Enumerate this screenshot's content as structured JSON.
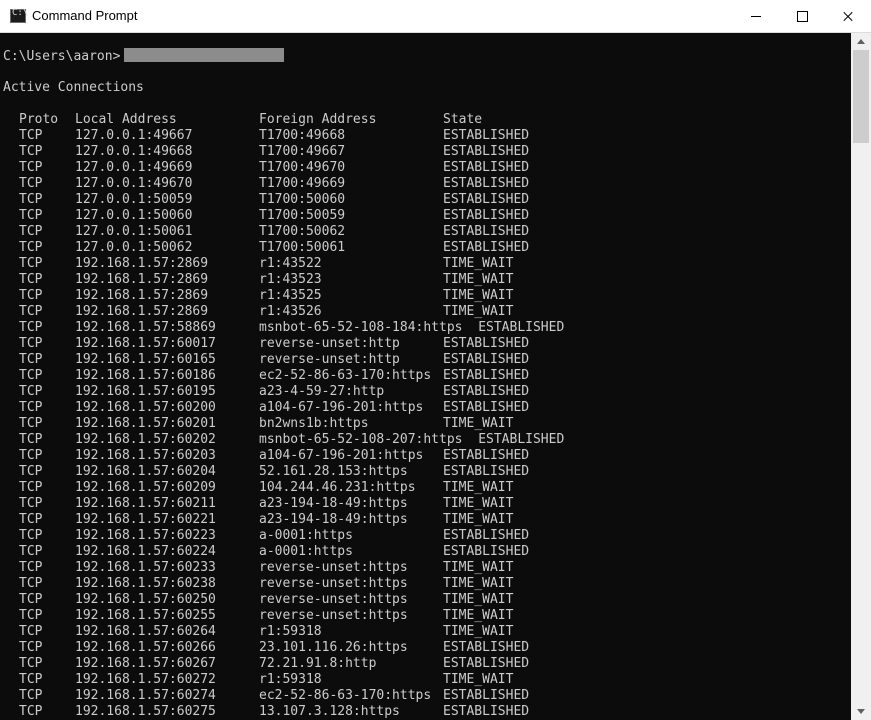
{
  "window": {
    "title": "Command Prompt",
    "icon": "cmd-icon",
    "icon_text": "C:\\"
  },
  "colors": {
    "console_bg": "#0c0c0c",
    "console_fg": "#cccccc",
    "titlebar_bg": "#ffffff",
    "redaction": "#8c8c8c"
  },
  "console": {
    "prompt": "C:\\Users\\aaron>",
    "section_heading": "Active Connections",
    "columns": {
      "proto": "Proto",
      "local": "Local Address",
      "foreign": "Foreign Address",
      "state": "State"
    },
    "rows": [
      [
        "TCP",
        "127.0.0.1:49667",
        "T1700:49668",
        "ESTABLISHED"
      ],
      [
        "TCP",
        "127.0.0.1:49668",
        "T1700:49667",
        "ESTABLISHED"
      ],
      [
        "TCP",
        "127.0.0.1:49669",
        "T1700:49670",
        "ESTABLISHED"
      ],
      [
        "TCP",
        "127.0.0.1:49670",
        "T1700:49669",
        "ESTABLISHED"
      ],
      [
        "TCP",
        "127.0.0.1:50059",
        "T1700:50060",
        "ESTABLISHED"
      ],
      [
        "TCP",
        "127.0.0.1:50060",
        "T1700:50059",
        "ESTABLISHED"
      ],
      [
        "TCP",
        "127.0.0.1:50061",
        "T1700:50062",
        "ESTABLISHED"
      ],
      [
        "TCP",
        "127.0.0.1:50062",
        "T1700:50061",
        "ESTABLISHED"
      ],
      [
        "TCP",
        "192.168.1.57:2869",
        "r1:43522",
        "TIME_WAIT"
      ],
      [
        "TCP",
        "192.168.1.57:2869",
        "r1:43523",
        "TIME_WAIT"
      ],
      [
        "TCP",
        "192.168.1.57:2869",
        "r1:43525",
        "TIME_WAIT"
      ],
      [
        "TCP",
        "192.168.1.57:2869",
        "r1:43526",
        "TIME_WAIT"
      ],
      [
        "TCP",
        "192.168.1.57:58869",
        "msnbot-65-52-108-184:https",
        "ESTABLISHED"
      ],
      [
        "TCP",
        "192.168.1.57:60017",
        "reverse-unset:http",
        "ESTABLISHED"
      ],
      [
        "TCP",
        "192.168.1.57:60165",
        "reverse-unset:http",
        "ESTABLISHED"
      ],
      [
        "TCP",
        "192.168.1.57:60186",
        "ec2-52-86-63-170:https",
        "ESTABLISHED"
      ],
      [
        "TCP",
        "192.168.1.57:60195",
        "a23-4-59-27:http",
        "ESTABLISHED"
      ],
      [
        "TCP",
        "192.168.1.57:60200",
        "a104-67-196-201:https",
        "ESTABLISHED"
      ],
      [
        "TCP",
        "192.168.1.57:60201",
        "bn2wns1b:https",
        "TIME_WAIT"
      ],
      [
        "TCP",
        "192.168.1.57:60202",
        "msnbot-65-52-108-207:https",
        "ESTABLISHED"
      ],
      [
        "TCP",
        "192.168.1.57:60203",
        "a104-67-196-201:https",
        "ESTABLISHED"
      ],
      [
        "TCP",
        "192.168.1.57:60204",
        "52.161.28.153:https",
        "ESTABLISHED"
      ],
      [
        "TCP",
        "192.168.1.57:60209",
        "104.244.46.231:https",
        "TIME_WAIT"
      ],
      [
        "TCP",
        "192.168.1.57:60211",
        "a23-194-18-49:https",
        "TIME_WAIT"
      ],
      [
        "TCP",
        "192.168.1.57:60221",
        "a23-194-18-49:https",
        "TIME_WAIT"
      ],
      [
        "TCP",
        "192.168.1.57:60223",
        "a-0001:https",
        "ESTABLISHED"
      ],
      [
        "TCP",
        "192.168.1.57:60224",
        "a-0001:https",
        "ESTABLISHED"
      ],
      [
        "TCP",
        "192.168.1.57:60233",
        "reverse-unset:https",
        "TIME_WAIT"
      ],
      [
        "TCP",
        "192.168.1.57:60238",
        "reverse-unset:https",
        "TIME_WAIT"
      ],
      [
        "TCP",
        "192.168.1.57:60250",
        "reverse-unset:https",
        "TIME_WAIT"
      ],
      [
        "TCP",
        "192.168.1.57:60255",
        "reverse-unset:https",
        "TIME_WAIT"
      ],
      [
        "TCP",
        "192.168.1.57:60264",
        "r1:59318",
        "TIME_WAIT"
      ],
      [
        "TCP",
        "192.168.1.57:60266",
        "23.101.116.26:https",
        "ESTABLISHED"
      ],
      [
        "TCP",
        "192.168.1.57:60267",
        "72.21.91.8:http",
        "ESTABLISHED"
      ],
      [
        "TCP",
        "192.168.1.57:60272",
        "r1:59318",
        "TIME_WAIT"
      ],
      [
        "TCP",
        "192.168.1.57:60274",
        "ec2-52-86-63-170:https",
        "ESTABLISHED"
      ],
      [
        "TCP",
        "192.168.1.57:60275",
        "13.107.3.128:https",
        "ESTABLISHED"
      ]
    ]
  }
}
